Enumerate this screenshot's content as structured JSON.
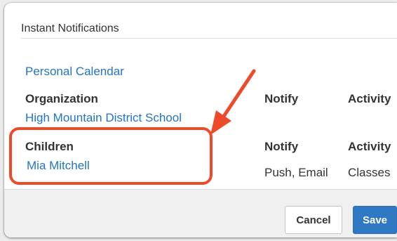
{
  "section": {
    "title": "Instant Notifications"
  },
  "personal_calendar": {
    "label": "Personal Calendar"
  },
  "organization": {
    "label": "Organization",
    "name": "High Mountain District School",
    "notify_header": "Notify",
    "activity_header": "Activity"
  },
  "children": {
    "label": "Children",
    "name": "Mia Mitchell",
    "notify_header": "Notify",
    "activity_header": "Activity",
    "notify_value": "Push, Email",
    "activity_value": "Classes"
  },
  "buttons": {
    "cancel": "Cancel",
    "save": "Save"
  },
  "colors": {
    "link": "#2274c4",
    "primary_button": "#2e78c4",
    "annotation": "#ee4a2a"
  }
}
